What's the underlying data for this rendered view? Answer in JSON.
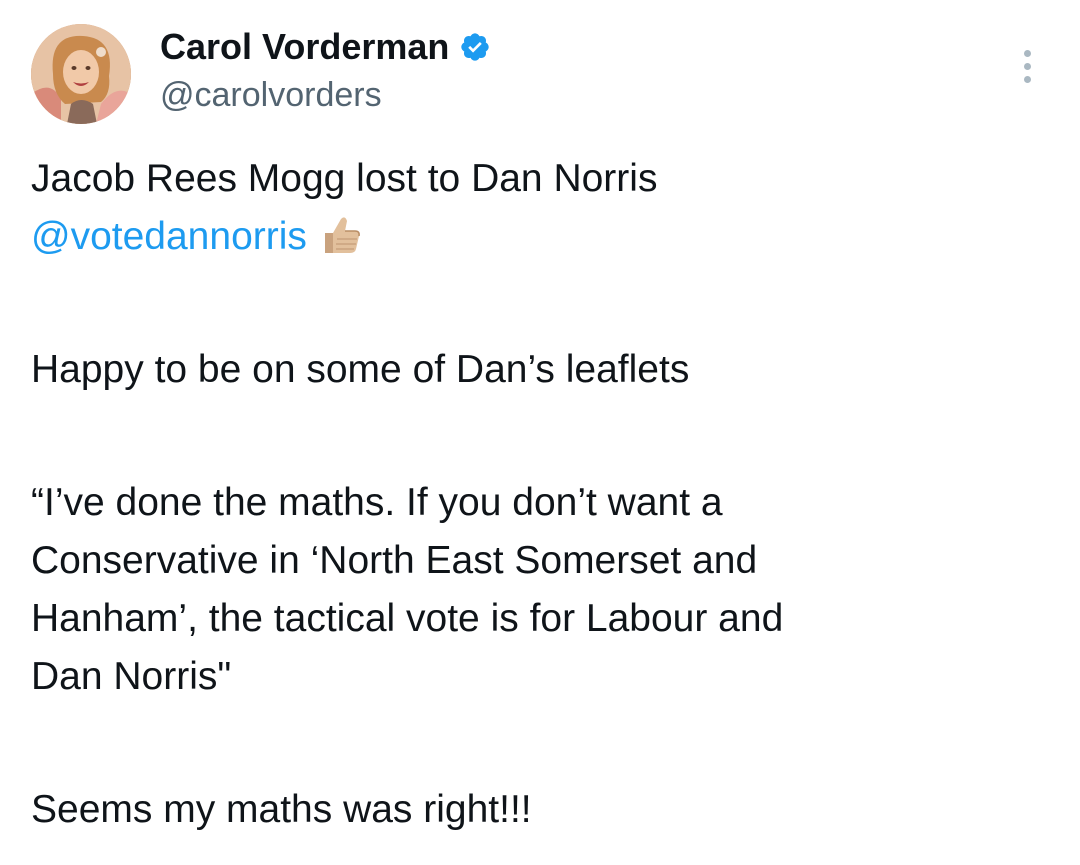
{
  "tweet": {
    "author": {
      "display_name": "Carol Vorderman",
      "handle": "@carolvorders",
      "verified_icon": "verified-badge-icon",
      "avatar": "profile-photo"
    },
    "more_icon": "more-options-icon",
    "lines": {
      "line1": "Jacob Rees Mogg lost to Dan Norris",
      "mention": "@votedannorris",
      "emoji": "thumbs-up-icon",
      "line3": "Happy to be on some of Dan’s leaflets",
      "line4": "“I’ve done the maths. If you don’t want a",
      "line5": "Conservative in ‘North East Somerset and",
      "line6": "Hanham’, the tactical vote is for Labour and",
      "line7": "Dan Norris\"",
      "line8": "Seems my maths was right!!!"
    },
    "colors": {
      "text": "#0f1419",
      "secondary": "#536471",
      "link": "#1d9bf0"
    }
  }
}
